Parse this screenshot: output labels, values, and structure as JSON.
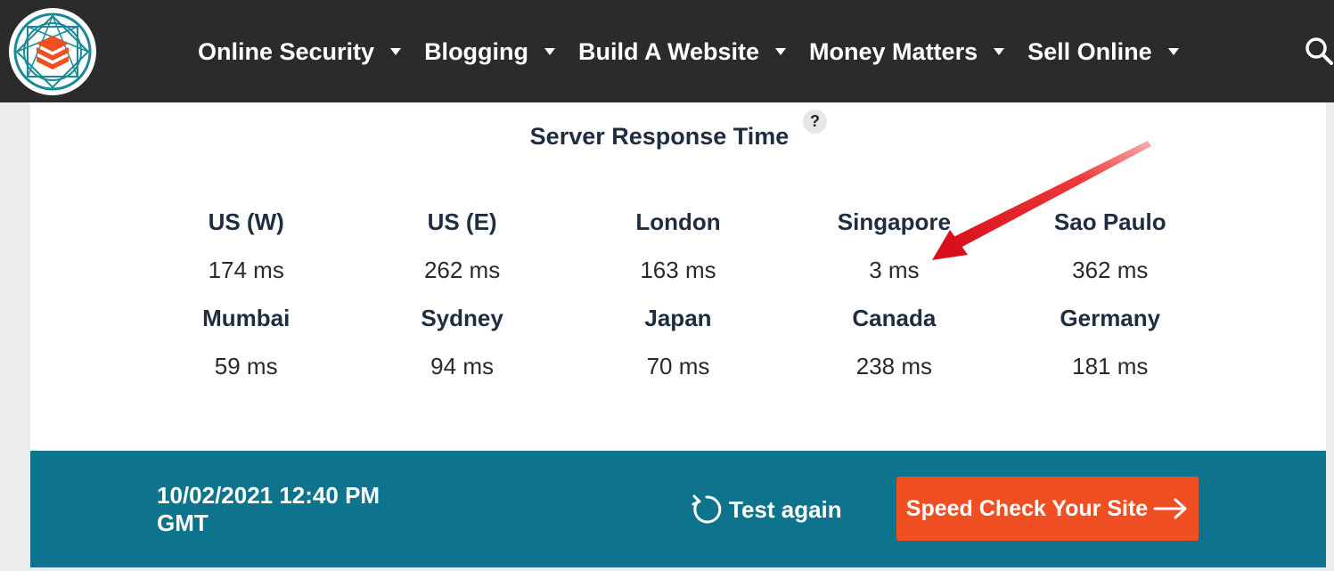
{
  "nav": {
    "items": [
      {
        "label": "Online Security"
      },
      {
        "label": "Blogging"
      },
      {
        "label": "Build A Website"
      },
      {
        "label": "Money Matters"
      },
      {
        "label": "Sell Online"
      }
    ],
    "icons": {
      "search": "search-icon",
      "logo": "site-logo",
      "dropdown": "caret-down-icon"
    }
  },
  "results": {
    "title": "Server Response Time",
    "help_label": "?",
    "locations": [
      {
        "name": "US (W)",
        "time": "174 ms"
      },
      {
        "name": "US (E)",
        "time": "262 ms"
      },
      {
        "name": "London",
        "time": "163 ms"
      },
      {
        "name": "Singapore",
        "time": "3 ms"
      },
      {
        "name": "Sao Paulo",
        "time": "362 ms"
      },
      {
        "name": "Mumbai",
        "time": "59 ms"
      },
      {
        "name": "Sydney",
        "time": "94 ms"
      },
      {
        "name": "Japan",
        "time": "70 ms"
      },
      {
        "name": "Canada",
        "time": "238 ms"
      },
      {
        "name": "Germany",
        "time": "181 ms"
      }
    ]
  },
  "footer": {
    "datetime": "10/02/2021 12:40 PM GMT",
    "test_again": "Test again",
    "speed_check": "Speed Check Your Site"
  },
  "colors": {
    "navbar": "#2b2b2b",
    "band": "#0e748d",
    "button": "#f04e23",
    "annotation_arrow": "#e8121b"
  }
}
